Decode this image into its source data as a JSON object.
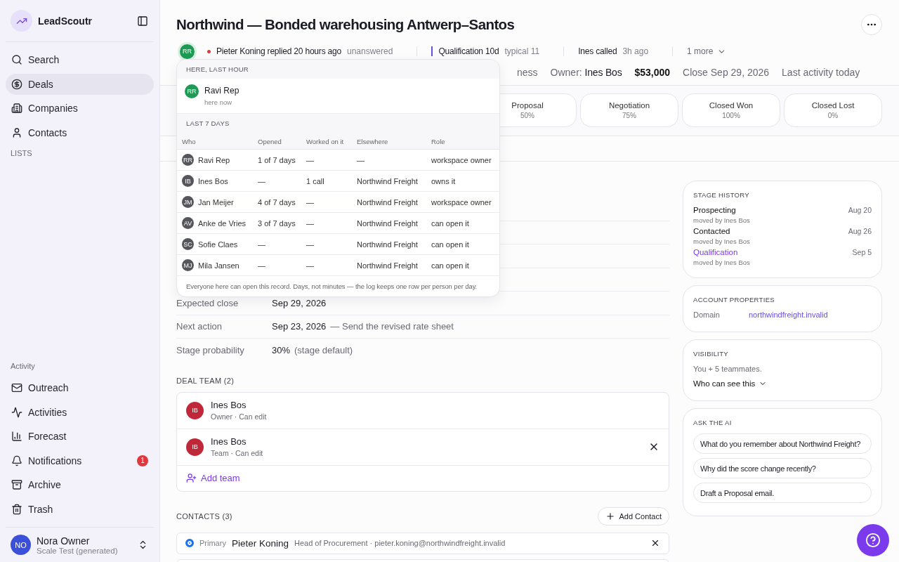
{
  "sidebar": {
    "brand": "LeadScoutr",
    "nav": [
      {
        "label": "Search",
        "selected": false
      },
      {
        "label": "Deals",
        "selected": true
      },
      {
        "label": "Companies",
        "selected": false
      },
      {
        "label": "Contacts",
        "selected": false
      }
    ],
    "lists_heading": "LISTS",
    "activity_heading": "Activity",
    "activity_nav": [
      {
        "label": "Outreach"
      },
      {
        "label": "Activities"
      },
      {
        "label": "Forecast"
      },
      {
        "label": "Notifications",
        "badge": "1"
      },
      {
        "label": "Archive"
      },
      {
        "label": "Trash"
      }
    ],
    "user": {
      "initials": "NO",
      "name": "Nora Owner",
      "subtitle": "Scale Test (generated)"
    }
  },
  "deal": {
    "title": "Northwind — Bonded warehousing Antwerp–Santos",
    "status": {
      "initials": "RR",
      "reply": "Pieter Koning replied 20 hours ago",
      "reply_state": "unanswered",
      "stage": "Qualification 10d",
      "stage_typical": "typical 11",
      "call": "Ines called",
      "call_time": "3h ago",
      "more": "1 more"
    },
    "meta": [
      {
        "kind": "plain",
        "text": "ness"
      },
      {
        "kind": "labelled",
        "label": "Owner:",
        "text": "Ines Bos"
      },
      {
        "kind": "amount",
        "text": "$53,000"
      },
      {
        "kind": "plain",
        "text": "Close Sep 29, 2026"
      },
      {
        "kind": "plain",
        "text": "Last activity today"
      }
    ],
    "stages": [
      {
        "name": "Proposal",
        "probability": "50%"
      },
      {
        "name": "Negotiation",
        "probability": "75%"
      },
      {
        "name": "Closed Won",
        "probability": "100%"
      },
      {
        "name": "Closed Lost",
        "probability": "0%"
      }
    ],
    "fields": [
      {
        "label": "Expected close",
        "value": "Sep 29, 2026"
      },
      {
        "label": "Next action",
        "value": "Sep 23, 2026",
        "note": "— Send the revised rate sheet"
      },
      {
        "label": "Stage probability",
        "value": "30%",
        "note": "(stage default)"
      }
    ],
    "deal_team": {
      "heading": "DEAL TEAM (2)",
      "add": "Add team",
      "members": [
        {
          "initials": "IB",
          "name": "Ines Bos",
          "role": "Owner",
          "separator": "·",
          "permission": "Can edit",
          "removable": false
        },
        {
          "initials": "IB",
          "name": "Ines Bos",
          "role": "Team",
          "separator": "·",
          "permission": "Can edit",
          "removable": true
        }
      ]
    },
    "contacts": {
      "heading": "CONTACTS (3)",
      "add": "Add Contact",
      "rows": [
        {
          "primary_label": "Primary",
          "selected": true,
          "name": "Pieter Koning",
          "detail": "Head of Procurement · pieter.koning@northwindfreight.invalid"
        }
      ]
    }
  },
  "presence": {
    "here_heading": "HERE, LAST HOUR",
    "here": {
      "initials": "RR",
      "name": "Ravi Rep",
      "status": "here now"
    },
    "week_heading": "LAST 7 DAYS",
    "columns": [
      "Who",
      "Opened",
      "Worked on it",
      "Elsewhere",
      "Role"
    ],
    "rows": [
      {
        "initials": "RR",
        "who": "Ravi Rep",
        "opened": "1 of 7 days",
        "worked": "—",
        "elsewhere": "—",
        "role": "workspace owner"
      },
      {
        "initials": "IB",
        "who": "Ines Bos",
        "opened": "—",
        "worked": "1 call",
        "elsewhere": "Northwind Freight",
        "role": "owns it"
      },
      {
        "initials": "JM",
        "who": "Jan Meijer",
        "opened": "4 of 7 days",
        "worked": "—",
        "elsewhere": "Northwind Freight",
        "role": "workspace owner"
      },
      {
        "initials": "AV",
        "who": "Anke de Vries",
        "opened": "3 of 7 days",
        "worked": "—",
        "elsewhere": "Northwind Freight",
        "role": "can open it"
      },
      {
        "initials": "SC",
        "who": "Sofie Claes",
        "opened": "—",
        "worked": "—",
        "elsewhere": "Northwind Freight",
        "role": "can open it"
      },
      {
        "initials": "MJ",
        "who": "Mila Jansen",
        "opened": "—",
        "worked": "—",
        "elsewhere": "Northwind Freight",
        "role": "can open it"
      }
    ],
    "footnote": "Everyone here can open this record. Days, not minutes — the log keeps one row per person per day."
  },
  "stage_history": {
    "heading": "STAGE HISTORY",
    "items": [
      {
        "stage": "Prospecting",
        "date": "Aug 20",
        "by": "moved by Ines Bos",
        "current": false
      },
      {
        "stage": "Contacted",
        "date": "Aug 26",
        "by": "moved by Ines Bos",
        "current": false
      },
      {
        "stage": "Qualification",
        "date": "Sep 5",
        "by": "moved by Ines Bos",
        "current": true
      }
    ]
  },
  "account": {
    "heading": "ACCOUNT PROPERTIES",
    "rows": [
      {
        "label": "Domain",
        "value": "northwindfreight.invalid"
      }
    ]
  },
  "visibility": {
    "heading": "VISIBILITY",
    "text": "You + 5 teammates.",
    "link": "Who can see this"
  },
  "ask_ai": {
    "heading": "ASK THE AI",
    "prompts": [
      "What do you remember about Northwind Freight?",
      "Why did the score change recently?",
      "Draft a Proposal email."
    ]
  }
}
